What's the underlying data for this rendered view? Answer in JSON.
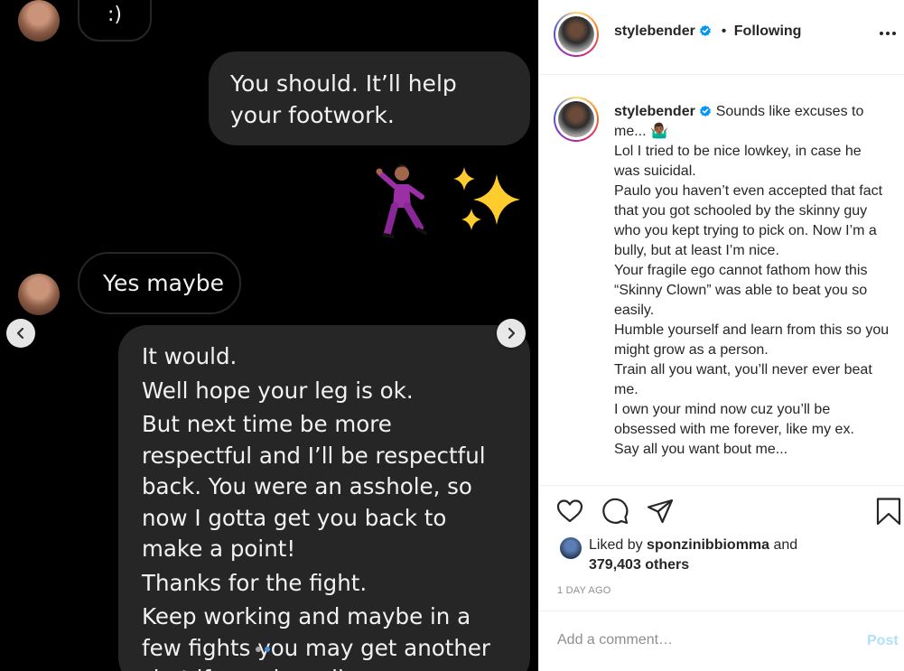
{
  "chat": {
    "smiley": ":)",
    "msg_1": "You should. It’ll help your footwork.",
    "msg_yes": "Yes maybe",
    "msg_2": [
      "It would.",
      "Well hope your leg is ok.",
      "But next time be more respectful and I’ll be respectful back. You were an asshole, so now I gotta get you back to make a point!",
      "Thanks for the fight.",
      "Keep working and maybe in a few fights you may get another shot if you do well."
    ],
    "carousel": {
      "dots_total": 2,
      "active_dot": 2
    }
  },
  "post": {
    "header": {
      "username": "stylebender",
      "separator": "•",
      "following_label": "Following"
    },
    "caption": {
      "username": "stylebender",
      "lines": [
        "Sounds like excuses to me... 🤷🏾‍♂️",
        "Lol I tried to be nice lowkey, in case he was suicidal.",
        "Paulo you haven’t even accepted that fact that you got schooled by the skinny guy who you kept trying to pick on. Now I’m a bully, but at least I’m nice.",
        "Your fragile ego cannot fathom how this “Skinny Clown” was able to beat you so easily.",
        "Humble yourself and learn from this so you might grow as a person.",
        "Train all you want, you’ll never ever beat me.",
        "I own your mind now cuz you’ll be obsessed with me forever, like my ex.",
        "Say all you want bout me..."
      ]
    },
    "likes": {
      "prefix": "Liked by",
      "user": "sponzinibbiomma",
      "and": "and",
      "others": "379,403 others"
    },
    "timestamp": "1 DAY AGO",
    "comment": {
      "placeholder": "Add a comment…",
      "post_label": "Post"
    },
    "colors": {
      "verified": "#0095f6",
      "post_disabled": "#b2dffc",
      "text": "#262626",
      "muted": "#8e8e8e"
    },
    "icons": [
      "heart-icon",
      "comment-icon",
      "share-icon",
      "save-icon",
      "more-icon",
      "verified-icon"
    ]
  }
}
